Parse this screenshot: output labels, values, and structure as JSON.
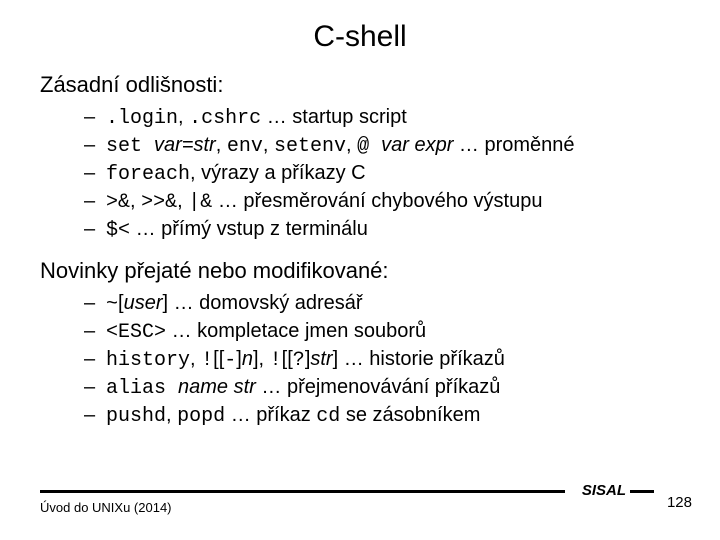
{
  "title": "C-shell",
  "section1": {
    "heading": "Zásadní odlišnosti:",
    "items": [
      {
        "code1": ".login",
        "sep1": ", ",
        "code2": ".cshrc",
        "rest": " … startup script"
      },
      {
        "code1": "set ",
        "ital1": "var=str",
        "sep1": ", ",
        "code2": "env",
        "sep2": ", ",
        "code3": "setenv",
        "sep3": ", ",
        "code4": "@ ",
        "ital2": "var expr",
        "rest": " … proměnné"
      },
      {
        "code1": "foreach",
        "rest": ", výrazy a příkazy C"
      },
      {
        "code1": ">&",
        "sep1": ", ",
        "code2": ">>&",
        "sep2": ", ",
        "code3": "|&",
        "rest": " … přesměrování chybového výstupu"
      },
      {
        "code1": "$<",
        "rest": " … přímý vstup z terminálu"
      }
    ]
  },
  "section2": {
    "heading": "Novinky přejaté nebo modifikované:",
    "items": [
      {
        "code1": "~",
        "sep1": "[",
        "ital1": "user",
        "sep2": "]",
        "rest": " … domovský adresář"
      },
      {
        "code1": "<ESC>",
        "rest": " … kompletace jmen souborů"
      },
      {
        "code1": "history",
        "sep1": ", ",
        "code2": "!",
        "sep2": "[[",
        "code3": "-",
        "sep3": "]",
        "ital1": "n",
        "sep4": "], ",
        "code4": "!",
        "sep5": "[[",
        "code5": "?",
        "sep6": "]",
        "ital2": "str",
        "sep7": "]",
        "rest": " … historie příkazů"
      },
      {
        "code1": "alias ",
        "ital1": "name str",
        "rest": " … přejmenovávání příkazů"
      },
      {
        "code1": "pushd",
        "sep1": ", ",
        "code2": "popd",
        "rest1": " … příkaz ",
        "code3": "cd",
        "rest": " se zásobníkem"
      }
    ]
  },
  "footer": {
    "left": "Úvod do UNIXu (2014)",
    "label": "SISAL",
    "page": "128"
  }
}
